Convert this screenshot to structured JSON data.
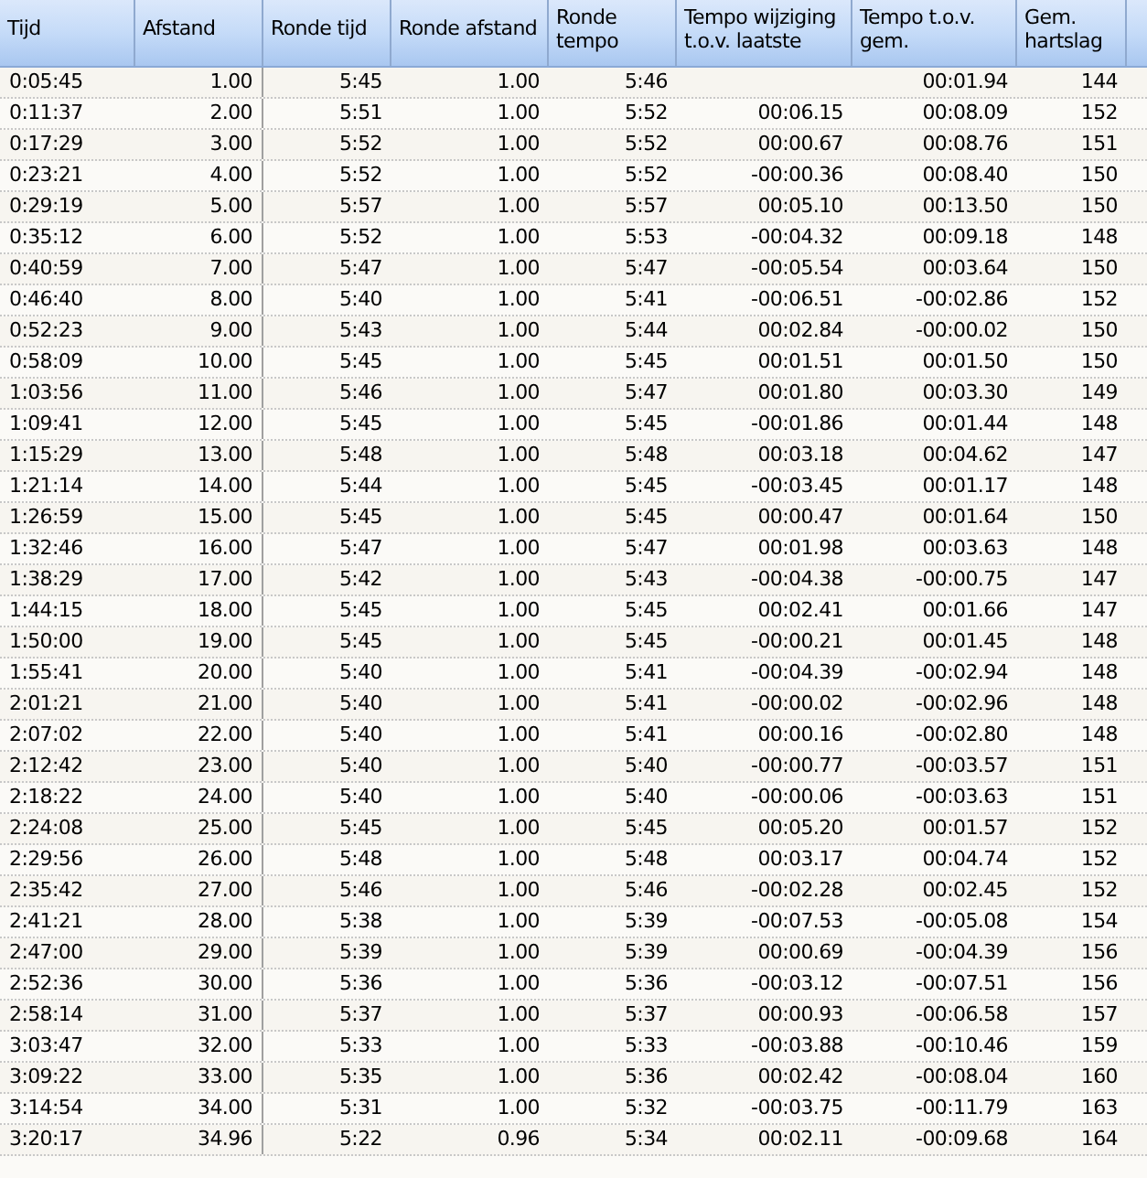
{
  "table": {
    "columns": [
      "Tijd",
      "Afstand",
      "Ronde tijd",
      "Ronde afstand",
      "Ronde tempo",
      "Tempo wijziging t.o.v. laatste",
      "Tempo t.o.v. gem.",
      "Gem. hartslag"
    ],
    "rows": [
      [
        "0:05:45",
        "1.00",
        "5:45",
        "1.00",
        "5:46",
        null,
        "00:01.94",
        "144"
      ],
      [
        "0:11:37",
        "2.00",
        "5:51",
        "1.00",
        "5:52",
        "00:06.15",
        "00:08.09",
        "152"
      ],
      [
        "0:17:29",
        "3.00",
        "5:52",
        "1.00",
        "5:52",
        "00:00.67",
        "00:08.76",
        "151"
      ],
      [
        "0:23:21",
        "4.00",
        "5:52",
        "1.00",
        "5:52",
        "-00:00.36",
        "00:08.40",
        "150"
      ],
      [
        "0:29:19",
        "5.00",
        "5:57",
        "1.00",
        "5:57",
        "00:05.10",
        "00:13.50",
        "150"
      ],
      [
        "0:35:12",
        "6.00",
        "5:52",
        "1.00",
        "5:53",
        "-00:04.32",
        "00:09.18",
        "148"
      ],
      [
        "0:40:59",
        "7.00",
        "5:47",
        "1.00",
        "5:47",
        "-00:05.54",
        "00:03.64",
        "150"
      ],
      [
        "0:46:40",
        "8.00",
        "5:40",
        "1.00",
        "5:41",
        "-00:06.51",
        "-00:02.86",
        "152"
      ],
      [
        "0:52:23",
        "9.00",
        "5:43",
        "1.00",
        "5:44",
        "00:02.84",
        "-00:00.02",
        "150"
      ],
      [
        "0:58:09",
        "10.00",
        "5:45",
        "1.00",
        "5:45",
        "00:01.51",
        "00:01.50",
        "150"
      ],
      [
        "1:03:56",
        "11.00",
        "5:46",
        "1.00",
        "5:47",
        "00:01.80",
        "00:03.30",
        "149"
      ],
      [
        "1:09:41",
        "12.00",
        "5:45",
        "1.00",
        "5:45",
        "-00:01.86",
        "00:01.44",
        "148"
      ],
      [
        "1:15:29",
        "13.00",
        "5:48",
        "1.00",
        "5:48",
        "00:03.18",
        "00:04.62",
        "147"
      ],
      [
        "1:21:14",
        "14.00",
        "5:44",
        "1.00",
        "5:45",
        "-00:03.45",
        "00:01.17",
        "148"
      ],
      [
        "1:26:59",
        "15.00",
        "5:45",
        "1.00",
        "5:45",
        "00:00.47",
        "00:01.64",
        "150"
      ],
      [
        "1:32:46",
        "16.00",
        "5:47",
        "1.00",
        "5:47",
        "00:01.98",
        "00:03.63",
        "148"
      ],
      [
        "1:38:29",
        "17.00",
        "5:42",
        "1.00",
        "5:43",
        "-00:04.38",
        "-00:00.75",
        "147"
      ],
      [
        "1:44:15",
        "18.00",
        "5:45",
        "1.00",
        "5:45",
        "00:02.41",
        "00:01.66",
        "147"
      ],
      [
        "1:50:00",
        "19.00",
        "5:45",
        "1.00",
        "5:45",
        "-00:00.21",
        "00:01.45",
        "148"
      ],
      [
        "1:55:41",
        "20.00",
        "5:40",
        "1.00",
        "5:41",
        "-00:04.39",
        "-00:02.94",
        "148"
      ],
      [
        "2:01:21",
        "21.00",
        "5:40",
        "1.00",
        "5:41",
        "-00:00.02",
        "-00:02.96",
        "148"
      ],
      [
        "2:07:02",
        "22.00",
        "5:40",
        "1.00",
        "5:41",
        "00:00.16",
        "-00:02.80",
        "148"
      ],
      [
        "2:12:42",
        "23.00",
        "5:40",
        "1.00",
        "5:40",
        "-00:00.77",
        "-00:03.57",
        "151"
      ],
      [
        "2:18:22",
        "24.00",
        "5:40",
        "1.00",
        "5:40",
        "-00:00.06",
        "-00:03.63",
        "151"
      ],
      [
        "2:24:08",
        "25.00",
        "5:45",
        "1.00",
        "5:45",
        "00:05.20",
        "00:01.57",
        "152"
      ],
      [
        "2:29:56",
        "26.00",
        "5:48",
        "1.00",
        "5:48",
        "00:03.17",
        "00:04.74",
        "152"
      ],
      [
        "2:35:42",
        "27.00",
        "5:46",
        "1.00",
        "5:46",
        "-00:02.28",
        "00:02.45",
        "152"
      ],
      [
        "2:41:21",
        "28.00",
        "5:38",
        "1.00",
        "5:39",
        "-00:07.53",
        "-00:05.08",
        "154"
      ],
      [
        "2:47:00",
        "29.00",
        "5:39",
        "1.00",
        "5:39",
        "00:00.69",
        "-00:04.39",
        "156"
      ],
      [
        "2:52:36",
        "30.00",
        "5:36",
        "1.00",
        "5:36",
        "-00:03.12",
        "-00:07.51",
        "156"
      ],
      [
        "2:58:14",
        "31.00",
        "5:37",
        "1.00",
        "5:37",
        "00:00.93",
        "-00:06.58",
        "157"
      ],
      [
        "3:03:47",
        "32.00",
        "5:33",
        "1.00",
        "5:33",
        "-00:03.88",
        "-00:10.46",
        "159"
      ],
      [
        "3:09:22",
        "33.00",
        "5:35",
        "1.00",
        "5:36",
        "00:02.42",
        "-00:08.04",
        "160"
      ],
      [
        "3:14:54",
        "34.00",
        "5:31",
        "1.00",
        "5:32",
        "-00:03.75",
        "-00:11.79",
        "163"
      ],
      [
        "3:20:17",
        "34.96",
        "5:22",
        "0.96",
        "5:34",
        "00:02.11",
        "-00:09.68",
        "164"
      ]
    ]
  }
}
